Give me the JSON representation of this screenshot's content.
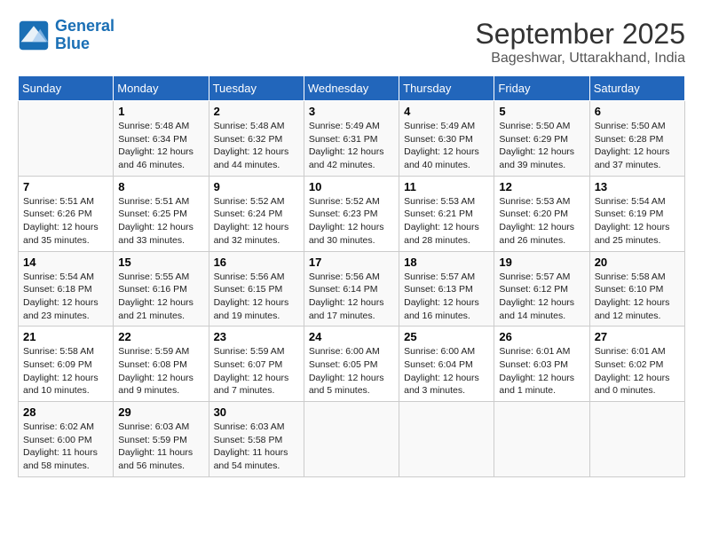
{
  "header": {
    "logo_line1": "General",
    "logo_line2": "Blue",
    "month": "September 2025",
    "location": "Bageshwar, Uttarakhand, India"
  },
  "weekdays": [
    "Sunday",
    "Monday",
    "Tuesday",
    "Wednesday",
    "Thursday",
    "Friday",
    "Saturday"
  ],
  "weeks": [
    [
      {
        "day": "",
        "info": ""
      },
      {
        "day": "1",
        "info": "Sunrise: 5:48 AM\nSunset: 6:34 PM\nDaylight: 12 hours\nand 46 minutes."
      },
      {
        "day": "2",
        "info": "Sunrise: 5:48 AM\nSunset: 6:32 PM\nDaylight: 12 hours\nand 44 minutes."
      },
      {
        "day": "3",
        "info": "Sunrise: 5:49 AM\nSunset: 6:31 PM\nDaylight: 12 hours\nand 42 minutes."
      },
      {
        "day": "4",
        "info": "Sunrise: 5:49 AM\nSunset: 6:30 PM\nDaylight: 12 hours\nand 40 minutes."
      },
      {
        "day": "5",
        "info": "Sunrise: 5:50 AM\nSunset: 6:29 PM\nDaylight: 12 hours\nand 39 minutes."
      },
      {
        "day": "6",
        "info": "Sunrise: 5:50 AM\nSunset: 6:28 PM\nDaylight: 12 hours\nand 37 minutes."
      }
    ],
    [
      {
        "day": "7",
        "info": "Sunrise: 5:51 AM\nSunset: 6:26 PM\nDaylight: 12 hours\nand 35 minutes."
      },
      {
        "day": "8",
        "info": "Sunrise: 5:51 AM\nSunset: 6:25 PM\nDaylight: 12 hours\nand 33 minutes."
      },
      {
        "day": "9",
        "info": "Sunrise: 5:52 AM\nSunset: 6:24 PM\nDaylight: 12 hours\nand 32 minutes."
      },
      {
        "day": "10",
        "info": "Sunrise: 5:52 AM\nSunset: 6:23 PM\nDaylight: 12 hours\nand 30 minutes."
      },
      {
        "day": "11",
        "info": "Sunrise: 5:53 AM\nSunset: 6:21 PM\nDaylight: 12 hours\nand 28 minutes."
      },
      {
        "day": "12",
        "info": "Sunrise: 5:53 AM\nSunset: 6:20 PM\nDaylight: 12 hours\nand 26 minutes."
      },
      {
        "day": "13",
        "info": "Sunrise: 5:54 AM\nSunset: 6:19 PM\nDaylight: 12 hours\nand 25 minutes."
      }
    ],
    [
      {
        "day": "14",
        "info": "Sunrise: 5:54 AM\nSunset: 6:18 PM\nDaylight: 12 hours\nand 23 minutes."
      },
      {
        "day": "15",
        "info": "Sunrise: 5:55 AM\nSunset: 6:16 PM\nDaylight: 12 hours\nand 21 minutes."
      },
      {
        "day": "16",
        "info": "Sunrise: 5:56 AM\nSunset: 6:15 PM\nDaylight: 12 hours\nand 19 minutes."
      },
      {
        "day": "17",
        "info": "Sunrise: 5:56 AM\nSunset: 6:14 PM\nDaylight: 12 hours\nand 17 minutes."
      },
      {
        "day": "18",
        "info": "Sunrise: 5:57 AM\nSunset: 6:13 PM\nDaylight: 12 hours\nand 16 minutes."
      },
      {
        "day": "19",
        "info": "Sunrise: 5:57 AM\nSunset: 6:12 PM\nDaylight: 12 hours\nand 14 minutes."
      },
      {
        "day": "20",
        "info": "Sunrise: 5:58 AM\nSunset: 6:10 PM\nDaylight: 12 hours\nand 12 minutes."
      }
    ],
    [
      {
        "day": "21",
        "info": "Sunrise: 5:58 AM\nSunset: 6:09 PM\nDaylight: 12 hours\nand 10 minutes."
      },
      {
        "day": "22",
        "info": "Sunrise: 5:59 AM\nSunset: 6:08 PM\nDaylight: 12 hours\nand 9 minutes."
      },
      {
        "day": "23",
        "info": "Sunrise: 5:59 AM\nSunset: 6:07 PM\nDaylight: 12 hours\nand 7 minutes."
      },
      {
        "day": "24",
        "info": "Sunrise: 6:00 AM\nSunset: 6:05 PM\nDaylight: 12 hours\nand 5 minutes."
      },
      {
        "day": "25",
        "info": "Sunrise: 6:00 AM\nSunset: 6:04 PM\nDaylight: 12 hours\nand 3 minutes."
      },
      {
        "day": "26",
        "info": "Sunrise: 6:01 AM\nSunset: 6:03 PM\nDaylight: 12 hours\nand 1 minute."
      },
      {
        "day": "27",
        "info": "Sunrise: 6:01 AM\nSunset: 6:02 PM\nDaylight: 12 hours\nand 0 minutes."
      }
    ],
    [
      {
        "day": "28",
        "info": "Sunrise: 6:02 AM\nSunset: 6:00 PM\nDaylight: 11 hours\nand 58 minutes."
      },
      {
        "day": "29",
        "info": "Sunrise: 6:03 AM\nSunset: 5:59 PM\nDaylight: 11 hours\nand 56 minutes."
      },
      {
        "day": "30",
        "info": "Sunrise: 6:03 AM\nSunset: 5:58 PM\nDaylight: 11 hours\nand 54 minutes."
      },
      {
        "day": "",
        "info": ""
      },
      {
        "day": "",
        "info": ""
      },
      {
        "day": "",
        "info": ""
      },
      {
        "day": "",
        "info": ""
      }
    ]
  ]
}
